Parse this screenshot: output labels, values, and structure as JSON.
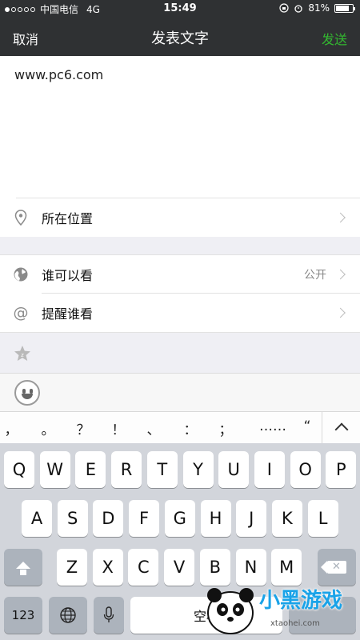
{
  "status_bar": {
    "carrier": "中国电信",
    "network": "4G",
    "time": "15:49",
    "battery_percent": "81%",
    "battery_level": 0.81
  },
  "nav": {
    "cancel": "取消",
    "title": "发表文字",
    "send": "发送"
  },
  "compose": {
    "text": "www.pc6.com"
  },
  "rows": {
    "location": {
      "label": "所在位置",
      "icon": "location-pin-icon"
    },
    "visibility": {
      "label": "谁可以看",
      "value": "公开",
      "icon": "globe-icon"
    },
    "mention": {
      "label": "提醒谁看",
      "icon": "at-icon"
    }
  },
  "toolbar": {
    "star_icon": "star-icon",
    "emoji_icon": "smiley-face-icon"
  },
  "punctuation": [
    "，",
    "。",
    "？",
    "！",
    "、",
    "：",
    "；",
    "……",
    "“"
  ],
  "keyboard": {
    "row1": [
      "Q",
      "W",
      "E",
      "R",
      "T",
      "Y",
      "U",
      "I",
      "O",
      "P"
    ],
    "row2": [
      "A",
      "S",
      "D",
      "F",
      "G",
      "H",
      "J",
      "K",
      "L"
    ],
    "row3": [
      "Z",
      "X",
      "C",
      "V",
      "B",
      "N",
      "M"
    ],
    "numbers_key": "123",
    "space_key": "空格"
  },
  "watermark": {
    "text": "小黑游戏",
    "url": "xtaohei.com"
  },
  "colors": {
    "nav_bg": "#2f3133",
    "send_green": "#33b830",
    "keyboard_bg": "#d2d5db"
  }
}
